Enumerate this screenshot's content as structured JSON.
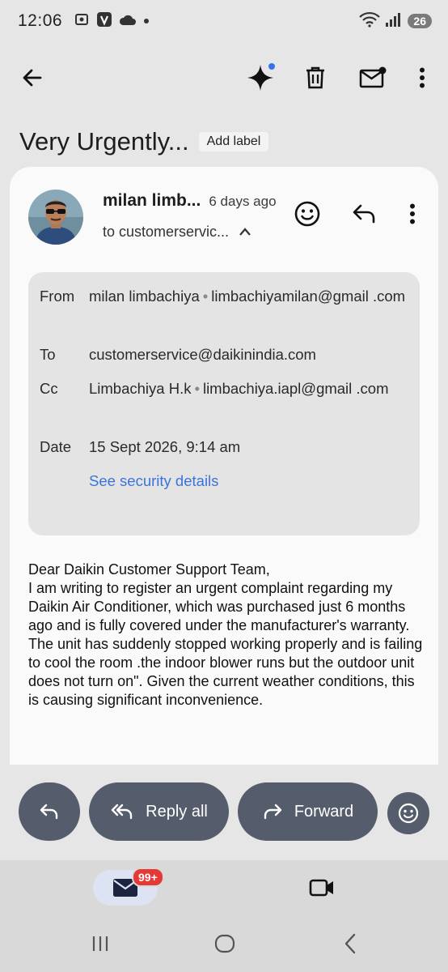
{
  "status_bar": {
    "time": "12:06",
    "battery": "26",
    "icons": [
      "screenshot-icon",
      "v-app-icon",
      "cloud-icon",
      "dot-icon",
      "wifi-icon",
      "signal-icon"
    ]
  },
  "toolbar": {
    "icons": [
      "back-arrow-icon",
      "gemini-sparkle-icon",
      "delete-icon",
      "mark-unread-icon",
      "more-vert-icon"
    ]
  },
  "subject": {
    "title": "Very Urgently...",
    "add_label": "Add label"
  },
  "message": {
    "sender_name": "milan limb...",
    "sent_time": "6 days ago",
    "to_summary": "to customerservic...",
    "details": {
      "from_label": "From",
      "from_name": "milan limbachiya",
      "from_email": "limbachiyamilan@gmail .com",
      "to_label": "To",
      "to_email": "customerservice@daikinindia.com",
      "cc_label": "Cc",
      "cc_name": "Limbachiya H.k",
      "cc_email": "limbachiya.iapl@gmail .com",
      "date_label": "Date",
      "date_value": "15 Sept 2026, 9:14 am",
      "security_link": "See security details"
    },
    "body": "Dear Daikin Customer Support Team,\nI am writing to register an urgent complaint regarding my Daikin Air Conditioner, which was purchased just 6 months ago and is fully covered under the manufacturer's warranty.\nThe unit has suddenly stopped working properly and is failing to cool the room .the indoor blower runs but the outdoor unit does not turn on\". Given the current weather conditions, this is causing significant inconvenience."
  },
  "actions": {
    "reply_all": "Reply all",
    "forward": "Forward"
  },
  "bottom_nav": {
    "mail_badge": "99+"
  },
  "colors": {
    "action_button": "#555c6b",
    "link": "#3b74d9",
    "badge": "#e53935"
  }
}
